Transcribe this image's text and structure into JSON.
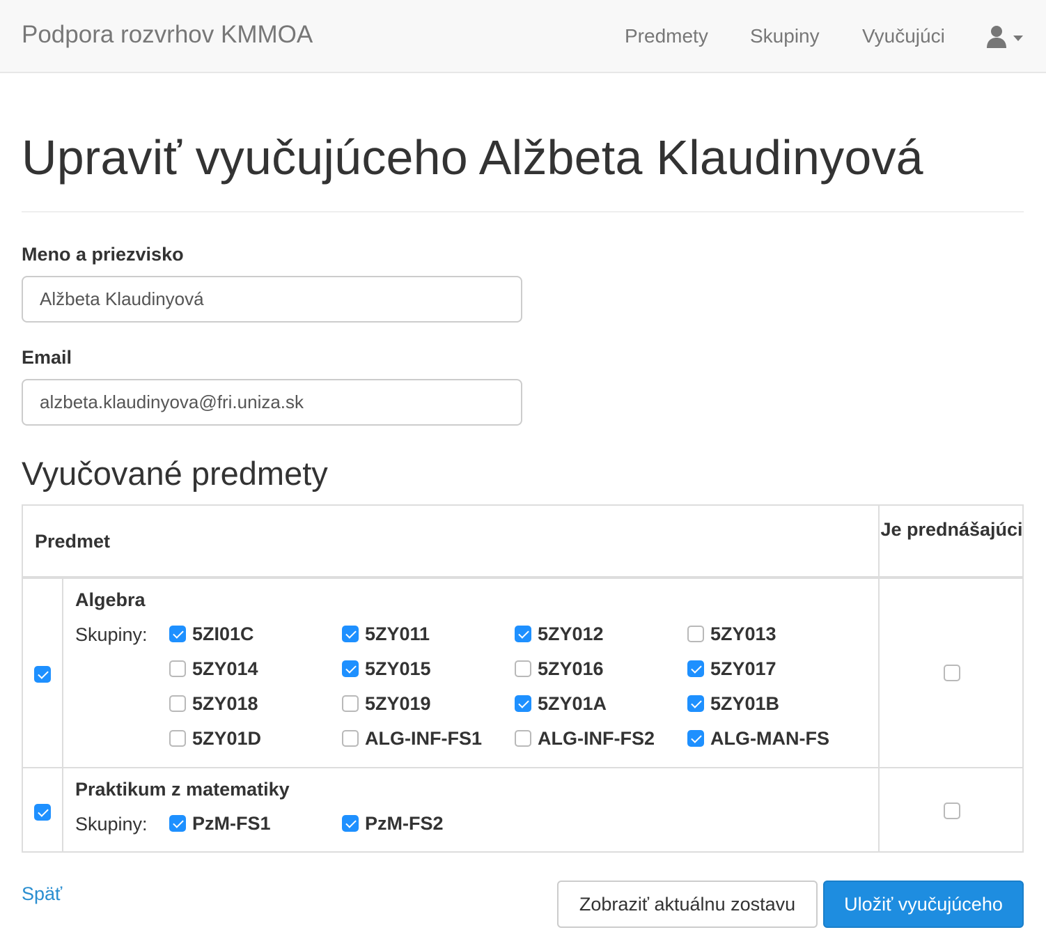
{
  "navbar": {
    "brand": "Podpora rozvrhov KMMOA",
    "links": [
      "Predmety",
      "Skupiny",
      "Vyučujúci"
    ],
    "user_icon": "user-icon",
    "caret_icon": "caret-down-icon"
  },
  "page": {
    "title": "Upraviť vyučujúceho Alžbeta Klaudinyová"
  },
  "form": {
    "name_label": "Meno a priezvisko",
    "name_value": "Alžbeta Klaudinyová",
    "email_label": "Email",
    "email_value": "alzbeta.klaudinyova@fri.uniza.sk"
  },
  "subjects": {
    "section_title": "Vyučované predmety",
    "col_subject": "Predmet",
    "col_lecturer": "Je prednášajúci",
    "groups_label": "Skupiny:",
    "rows": [
      {
        "name": "Algebra",
        "selected": true,
        "is_lecturer": false,
        "groups": [
          {
            "name": "5ZI01C",
            "checked": true
          },
          {
            "name": "5ZY011",
            "checked": true
          },
          {
            "name": "5ZY012",
            "checked": true
          },
          {
            "name": "5ZY013",
            "checked": false
          },
          {
            "name": "5ZY014",
            "checked": false
          },
          {
            "name": "5ZY015",
            "checked": true
          },
          {
            "name": "5ZY016",
            "checked": false
          },
          {
            "name": "5ZY017",
            "checked": true
          },
          {
            "name": "5ZY018",
            "checked": false
          },
          {
            "name": "5ZY019",
            "checked": false
          },
          {
            "name": "5ZY01A",
            "checked": true
          },
          {
            "name": "5ZY01B",
            "checked": true
          },
          {
            "name": "5ZY01D",
            "checked": false
          },
          {
            "name": "ALG-INF-FS1",
            "checked": false
          },
          {
            "name": "ALG-INF-FS2",
            "checked": false
          },
          {
            "name": "ALG-MAN-FS",
            "checked": true
          }
        ]
      },
      {
        "name": "Praktikum z matematiky",
        "selected": true,
        "is_lecturer": false,
        "groups": [
          {
            "name": "PzM-FS1",
            "checked": true
          },
          {
            "name": "PzM-FS2",
            "checked": true
          }
        ]
      }
    ]
  },
  "actions": {
    "back": "Späť",
    "show_report": "Zobraziť aktuálnu zostavu",
    "save": "Uložiť vyučujúceho"
  },
  "colors": {
    "primary": "#1e8de0",
    "checkbox_checked": "#1e90ff",
    "link": "#2a8ed0"
  }
}
